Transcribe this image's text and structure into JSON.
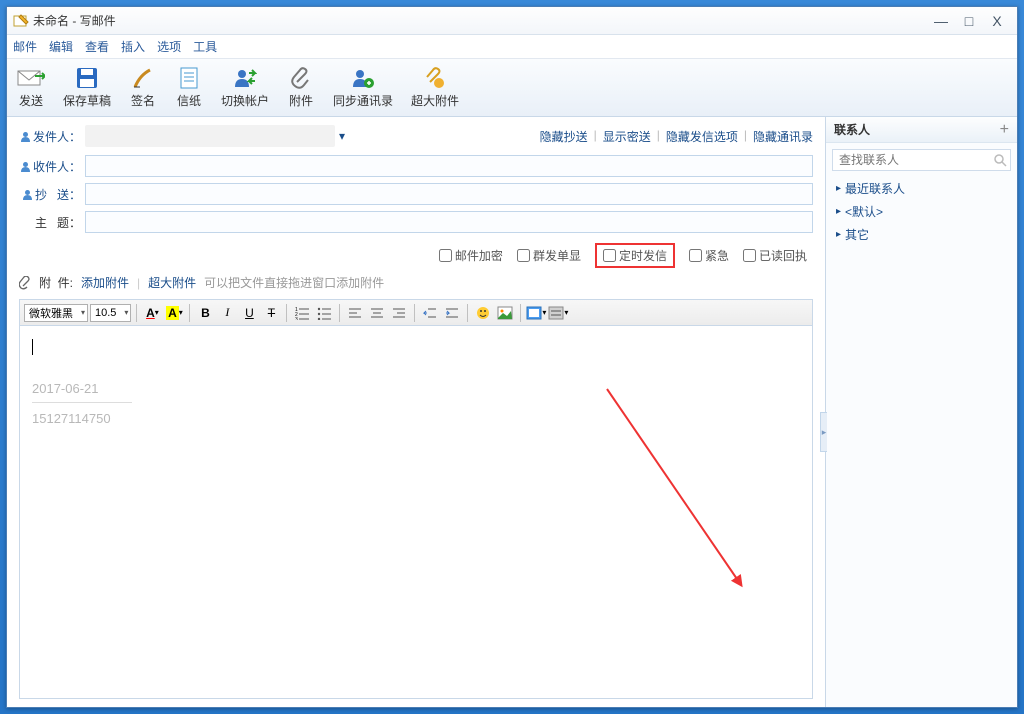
{
  "titlebar": {
    "title": "未命名 - 写邮件"
  },
  "win_controls": {
    "min": "—",
    "max": "□",
    "close": "X"
  },
  "menubar": [
    "邮件",
    "编辑",
    "查看",
    "插入",
    "选项",
    "工具"
  ],
  "toolbar": {
    "send": "发送",
    "save_draft": "保存草稿",
    "signature": "签名",
    "stationery": "信纸",
    "switch_account": "切换帐户",
    "attachment": "附件",
    "sync_contacts": "同步通讯录",
    "huge_attach": "超大附件"
  },
  "compose": {
    "sender_label": "发件人：",
    "recipient_label": "收件人：",
    "cc_label": "抄   送：",
    "subject_label": "主   题：",
    "recipient": "",
    "cc": "",
    "subject": ""
  },
  "header_links": {
    "hide_bcc": "隐藏抄送",
    "show_bcc": "显示密送",
    "hide_send_opts": "隐藏发信选项",
    "hide_contacts": "隐藏通讯录"
  },
  "options": {
    "encrypt": "邮件加密",
    "single_show": "群发单显",
    "schedule": "定时发信",
    "urgent": "紧急",
    "receipt": "已读回执"
  },
  "attach": {
    "label": "附  件:",
    "add": "添加附件",
    "huge": "超大附件",
    "hint": "可以把文件直接拖进窗口添加附件"
  },
  "editor_toolbar": {
    "font": "微软雅黑",
    "size": "10.5"
  },
  "editor_body": {
    "date": "2017-06-21",
    "phone": "15127114750"
  },
  "side": {
    "title": "联系人",
    "search_placeholder": "查找联系人",
    "groups": [
      "最近联系人",
      "<默认>",
      "其它"
    ]
  }
}
